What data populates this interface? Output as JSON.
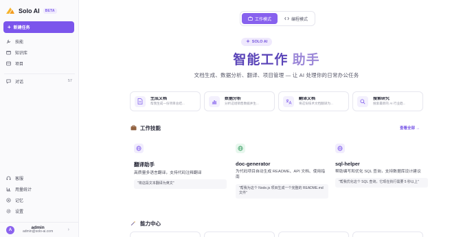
{
  "sidebar": {
    "brand": {
      "name": "Solo AI",
      "badge": "BETA"
    },
    "new_task_label": "新建任务",
    "nav_top": [
      {
        "label": "技能",
        "icon": "tools-icon"
      },
      {
        "label": "知识库",
        "icon": "folder-icon"
      },
      {
        "label": "项目",
        "icon": "project-icon"
      }
    ],
    "chat": {
      "label": "对话",
      "count": "57"
    },
    "nav_bottom": [
      {
        "label": "客服",
        "icon": "headset-icon"
      },
      {
        "label": "用量统计",
        "icon": "chart-icon"
      },
      {
        "label": "记忆",
        "icon": "memory-icon"
      },
      {
        "label": "设置",
        "icon": "settings-icon"
      }
    ],
    "user": {
      "avatar_letter": "A",
      "name": "admin",
      "email": "admin@solo-ai.com"
    }
  },
  "main": {
    "modes": {
      "work": "工作模式",
      "code": "编程模式",
      "active": "work"
    },
    "pill": "SOLO AI",
    "hero": {
      "title_a": "智能工作",
      "title_b": "助手",
      "subtitle": "文档生成、数据分析、翻译、项目管理 — 让 AI 处理你的日常办公任务"
    },
    "quick_cards": [
      {
        "title": "生成文档",
        "desc": "帮我生成一份项目总结...",
        "icon": "document-icon"
      },
      {
        "title": "数据分析",
        "desc": "分析这组销售数据并生...",
        "icon": "bar-chart-icon"
      },
      {
        "title": "翻译文档",
        "desc": "将这份技术文档翻译为...",
        "icon": "translate-icon"
      },
      {
        "title": "搜索研究",
        "desc": "搜索最新的 AI 行业趋...",
        "icon": "search-icon"
      }
    ],
    "skills_section": {
      "title": "工作技能",
      "see_all": "查看全部"
    },
    "skills": [
      {
        "name": "翻译助手",
        "desc": "高质量多语言翻译，支持代码注释翻译",
        "example": "\"将这段文本翻译为英文\"",
        "icon": "globe-icon"
      },
      {
        "name": "doc-generator",
        "desc": "为代码项目自动生成 README、API 文档、使用指南",
        "example": "\"帮我为这个 Node.js 项目生成一个完整的 README.md 文件\"",
        "icon": "globe-icon"
      },
      {
        "name": "sql-helper",
        "desc": "帮助编写和优化 SQL 查询，支持数据库设计建议",
        "example": "\"帮我优化这个 SQL 查询，它现在执行需要 5 秒以上\"",
        "icon": "globe-icon"
      }
    ],
    "capability_section": {
      "title": "能力中心"
    }
  }
}
